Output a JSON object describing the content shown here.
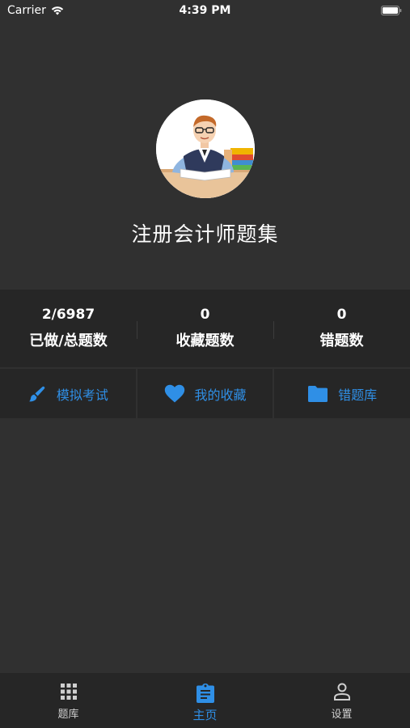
{
  "status_bar": {
    "carrier": "Carrier",
    "time": "4:39 PM"
  },
  "header": {
    "title": "注册会计师题集"
  },
  "stats": [
    {
      "value": "2/6987",
      "label": "已做/总题数"
    },
    {
      "value": "0",
      "label": "收藏题数"
    },
    {
      "value": "0",
      "label": "错题数"
    }
  ],
  "actions": [
    {
      "label": "模拟考试",
      "icon": "brush-icon"
    },
    {
      "label": "我的收藏",
      "icon": "heart-icon"
    },
    {
      "label": "错题库",
      "icon": "folder-icon"
    }
  ],
  "tabbar": [
    {
      "label": "题库",
      "icon": "grid-icon",
      "active": false
    },
    {
      "label": "主页",
      "icon": "clipboard-icon",
      "active": true
    },
    {
      "label": "设置",
      "icon": "person-icon",
      "active": false
    }
  ],
  "colors": {
    "accent": "#2f8fe6",
    "background": "#303030",
    "panel": "#262626"
  }
}
